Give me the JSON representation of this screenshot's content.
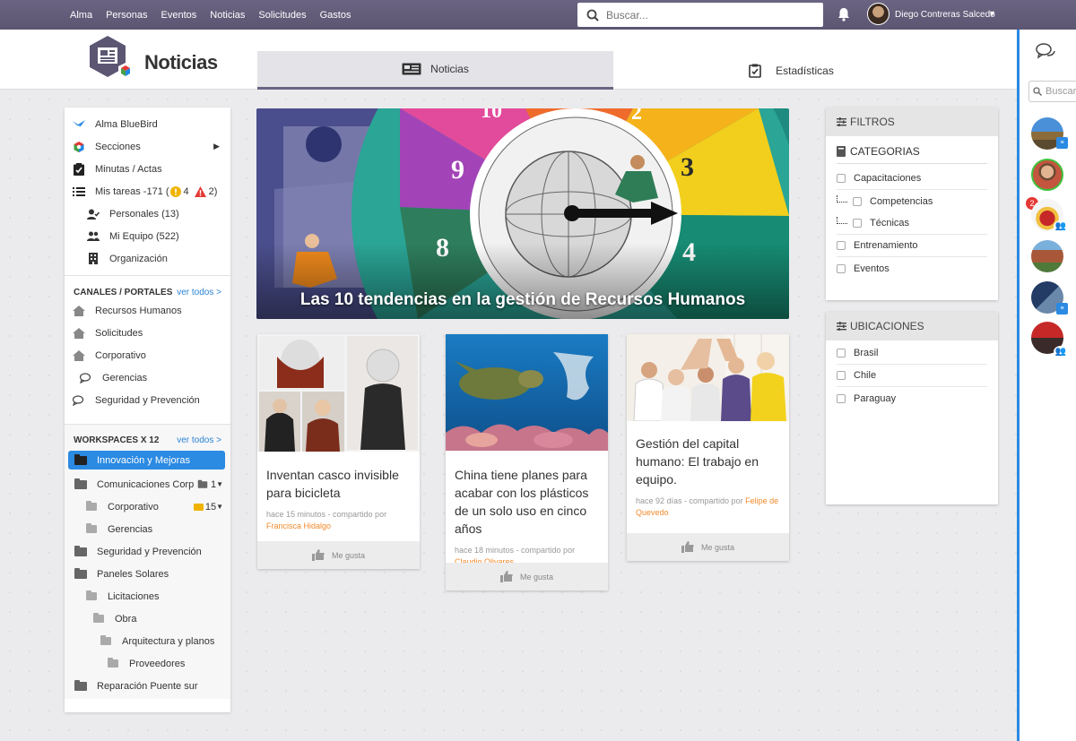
{
  "topnav": {
    "items": [
      "Alma",
      "Personas",
      "Eventos",
      "Noticias",
      "Solicitudes",
      "Gastos"
    ],
    "search_placeholder": "Buscar...",
    "user_name": "Diego Contreras Salcedo"
  },
  "header": {
    "title": "Noticias",
    "tabs": [
      {
        "label": "Noticias"
      },
      {
        "label": "Estadísticas"
      }
    ]
  },
  "sidebar": {
    "main": [
      {
        "label": "Alma BlueBird",
        "icon": "bird-icon"
      },
      {
        "label": "Secciones",
        "icon": "hexagon-icon"
      },
      {
        "label": "Minutas / Actas",
        "icon": "clipboard-check-icon"
      },
      {
        "label": "Mis tareas -171 (",
        "icon": "tasks-icon",
        "warn_count": "4",
        "alert_count": "2)"
      },
      {
        "label": "Personales (13)",
        "icon": "user-check-icon"
      },
      {
        "label": "Mi Equipo (522)",
        "icon": "users-icon"
      },
      {
        "label": "Organización",
        "icon": "building-icon"
      }
    ],
    "channels_header": "CANALES / PORTALES",
    "channels_link": "ver todos >",
    "channels": [
      {
        "label": "Recursos Humanos",
        "icon": "home-icon"
      },
      {
        "label": "Solicitudes",
        "icon": "home-icon"
      },
      {
        "label": "Corporativo",
        "icon": "home-icon"
      },
      {
        "label": "Gerencias",
        "icon": "chat-icon"
      },
      {
        "label": "Seguridad y Prevención",
        "icon": "chat-icon"
      }
    ],
    "workspaces_header": "WORKSPACES X 12",
    "workspaces_link": "ver todos >",
    "workspaces": [
      {
        "label": "Innovación y Mejoras",
        "level": 0
      },
      {
        "label": "Comunicaciones Corp",
        "level": 0,
        "count": "1"
      },
      {
        "label": "Corporativo",
        "level": 1,
        "count": "15"
      },
      {
        "label": "Gerencias",
        "level": 1
      },
      {
        "label": "Seguridad y Prevención",
        "level": 0
      },
      {
        "label": "Paneles Solares",
        "level": 0
      },
      {
        "label": "Licitaciones",
        "level": 1
      },
      {
        "label": "Obra",
        "level": 2
      },
      {
        "label": "Arquitectura y planos",
        "level": 3
      },
      {
        "label": "Proveedores",
        "level": 4
      },
      {
        "label": "Reparación Puente sur",
        "level": 0
      }
    ]
  },
  "hero": {
    "title": "Las 10 tendencias en la gestión de Recursos Humanos"
  },
  "cards": [
    {
      "title": "Inventan casco invisible para bicicleta",
      "meta": "hace 15 minutos - compartido por",
      "author": "Francisca Hidalgo",
      "like": "Me gusta"
    },
    {
      "title": "China tiene planes para acabar con los plásticos de un solo uso en cinco años",
      "meta": "hace 18 minutos - compartido por",
      "author": "Claudio Olivares",
      "like": "Me gusta"
    },
    {
      "title": "Gestión del capital humano: El trabajo en equipo.",
      "meta": "hace 92 días - compartido por",
      "author": "Felipe de Quevedo",
      "like": "Me gusta"
    }
  ],
  "filters": {
    "header": "FILTROS",
    "category_label": "CATEGORIAS",
    "categories": [
      "Capacitaciones",
      "Competencias",
      "Técnicas",
      "Entrenamiento",
      "Eventos"
    ],
    "locations_header": "UBICACIONES",
    "locations": [
      "Brasil",
      "Chile",
      "Paraguay"
    ]
  },
  "rail": {
    "search_placeholder": "Buscar",
    "notification_count": "2"
  },
  "colors": {
    "topbar": "#625c78",
    "accent": "#2b8ae2",
    "author": "#f28a2b"
  }
}
